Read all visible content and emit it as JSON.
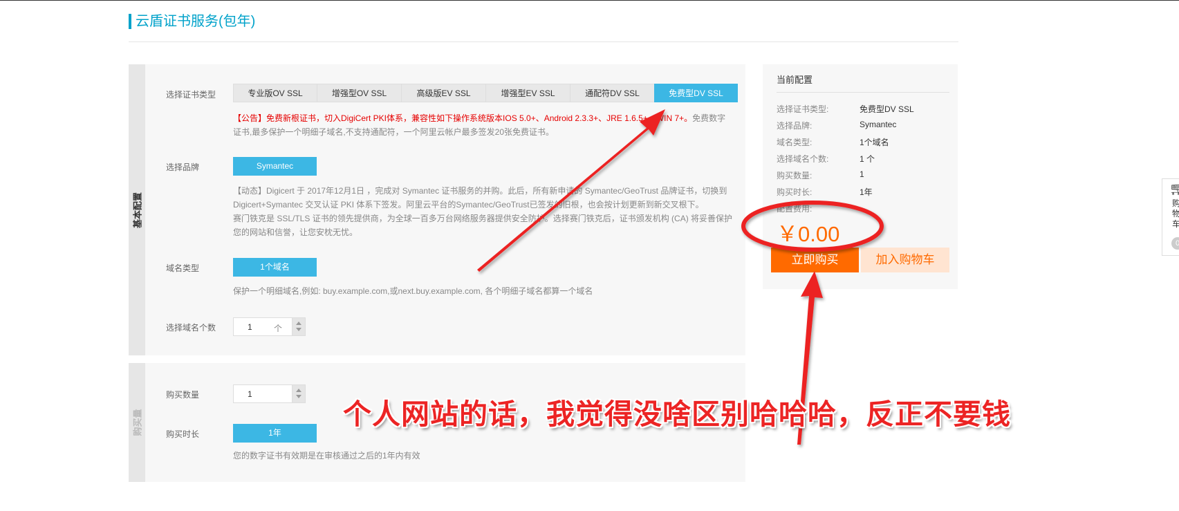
{
  "page": {
    "title": "云盾证书服务(包年)"
  },
  "basic_section": {
    "side_label": "基本配置",
    "cert_type": {
      "label": "选择证书类型",
      "tabs": [
        "专业版OV SSL",
        "增强型OV SSL",
        "高级版EV SSL",
        "增强型EV SSL",
        "通配符DV SSL",
        "免费型DV SSL"
      ],
      "active_index": 5,
      "notice_red": "【公告】免费新根证书，切入DigiCert PKI体系，兼容性如下操作系统版本IOS 5.0+、Android 2.3.3+、JRE 1.6.5+、WIN 7+。",
      "notice_gray": "免费数字证书,最多保护一个明细子域名,不支持通配符，一个阿里云帐户最多签发20张免费证书。"
    },
    "brand": {
      "label": "选择品牌",
      "value": "Symantec",
      "desc_line1": "【动态】Digicert 于 2017年12月1日 ，完成对 Symantec 证书服务的并购。此后，所有新申请的 Symantec/GeoTrust 品牌证书，切换到 Digicert+Symantec 交叉认证 PKI 体系下签发。阿里云平台的Symantec/GeoTrust已签发的旧根，也会按计划更新到新交叉根下。",
      "desc_line2": "赛门铁克是 SSL/TLS 证书的领先提供商，为全球一百多万台网络服务器提供安全防护。选择赛门铁克后，证书颁发机构 (CA) 将妥善保护您的网站和信誉，让您安枕无忧。"
    },
    "domain_type": {
      "label": "域名类型",
      "value": "1个域名",
      "desc": "保护一个明细域名,例如: buy.example.com,或next.buy.example.com, 各个明细子域名都算一个域名"
    },
    "domain_count": {
      "label": "选择域名个数",
      "value": "1",
      "unit": "个"
    }
  },
  "purchase_section": {
    "side_label": "购买量",
    "quantity": {
      "label": "购买数量",
      "value": "1"
    },
    "duration": {
      "label": "购买时长",
      "value": "1年",
      "desc": "您的数字证书有效期是在审核通过之后的1年内有效"
    }
  },
  "config_panel": {
    "title": "当前配置",
    "rows": [
      {
        "k": "选择证书类型:",
        "v": "免费型DV SSL"
      },
      {
        "k": "选择品牌:",
        "v": "Symantec"
      },
      {
        "k": "域名类型:",
        "v": "1个域名"
      },
      {
        "k": "选择域名个数:",
        "v": "1 个"
      },
      {
        "k": "购买数量:",
        "v": "1"
      },
      {
        "k": "购买时长:",
        "v": "1年"
      }
    ],
    "price_label": "配置费用:",
    "price": "￥0.00",
    "buy_label": "立即购买",
    "cart_label": "加入购物车"
  },
  "float_cart": {
    "label": "购物车",
    "count": "0"
  },
  "annotation": {
    "text": "个人网站的话，我觉得没啥区别哈哈哈，反正不要钱",
    "color": "#ec2424"
  },
  "colors": {
    "accent": "#3cb7e4",
    "orange": "#ff6a00",
    "annotation_red": "#ec2424"
  }
}
